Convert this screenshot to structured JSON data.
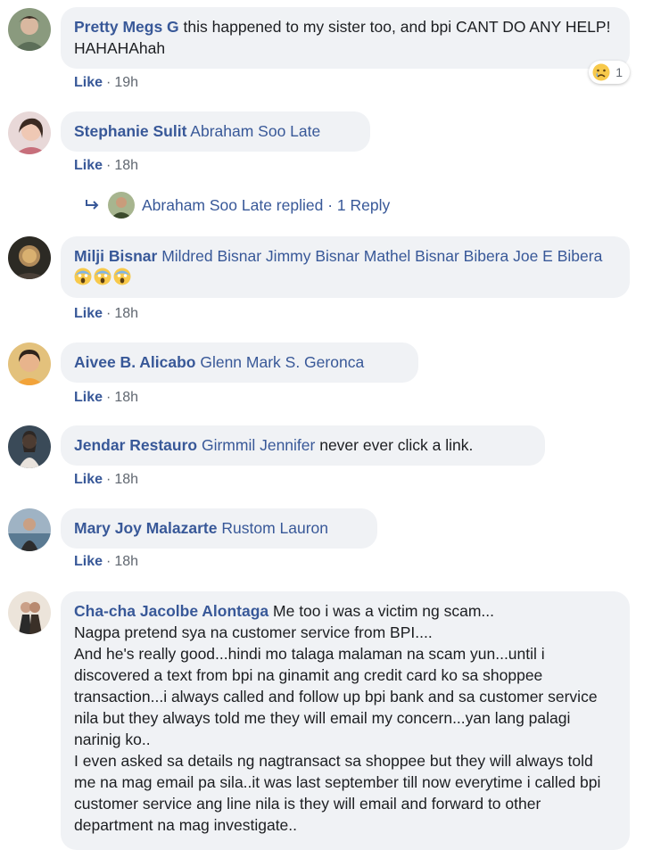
{
  "comments": [
    {
      "name": "Pretty Megs G",
      "tag": "",
      "text": " this happened to my sister too, and bpi CANT DO ANY HELP! HAHAHAhah",
      "like": "Like",
      "time": "19h",
      "reaction": {
        "icon": "sad-face-icon",
        "count": "1"
      }
    },
    {
      "name": "Stephanie Sulit",
      "tag": " Abraham Soo Late",
      "text": "",
      "like": "Like",
      "time": "18h"
    },
    {
      "name": "Milji Bisnar",
      "tag": " Mildred Bisnar Jimmy Bisnar Mathel Bisnar Bibera Joe E Bibera",
      "text": " ",
      "like": "Like",
      "time": "18h",
      "emojis": [
        "scream-face-icon",
        "scream-face-icon",
        "scream-face-icon"
      ]
    },
    {
      "name": "Aivee B. Alicabo",
      "tag": " Glenn Mark S. Geronca",
      "text": "",
      "like": "Like",
      "time": "18h"
    },
    {
      "name": "Jendar Restauro",
      "tag": " Girmmil Jennifer",
      "text": " never ever click a link.",
      "like": "Like",
      "time": "18h"
    },
    {
      "name": "Mary Joy Malazarte",
      "tag": " Rustom Lauron",
      "text": "",
      "like": "Like",
      "time": "18h"
    },
    {
      "name": "Cha-cha Jacolbe Alontaga",
      "tag": "",
      "text": " Me too i was a victim ng scam...\nNagpa pretend sya na customer service from BPI....\nAnd he's really good...hindi mo talaga malaman na scam yun...until i discovered a text from bpi na ginamit ang credit card ko sa shoppee transaction...i always called and follow up bpi bank and sa customer service nila but they always told me they will email my concern...yan lang palagi narinig ko..\nI even asked sa details ng nagtransact sa shoppee but they will always told me na mag email pa sila..it was last september till now everytime i called bpi customer service ang line nila is they will email and forward to other department na mag investigate.."
    }
  ],
  "reply": {
    "icon": "reply-arrow-icon",
    "author": "Abraham Soo Late",
    "label": " replied",
    "sep": " · ",
    "count": "1 Reply"
  },
  "sep": "·",
  "colors": {
    "link": "#385898",
    "bubble": "#f0f2f5",
    "meta": "#606770"
  }
}
